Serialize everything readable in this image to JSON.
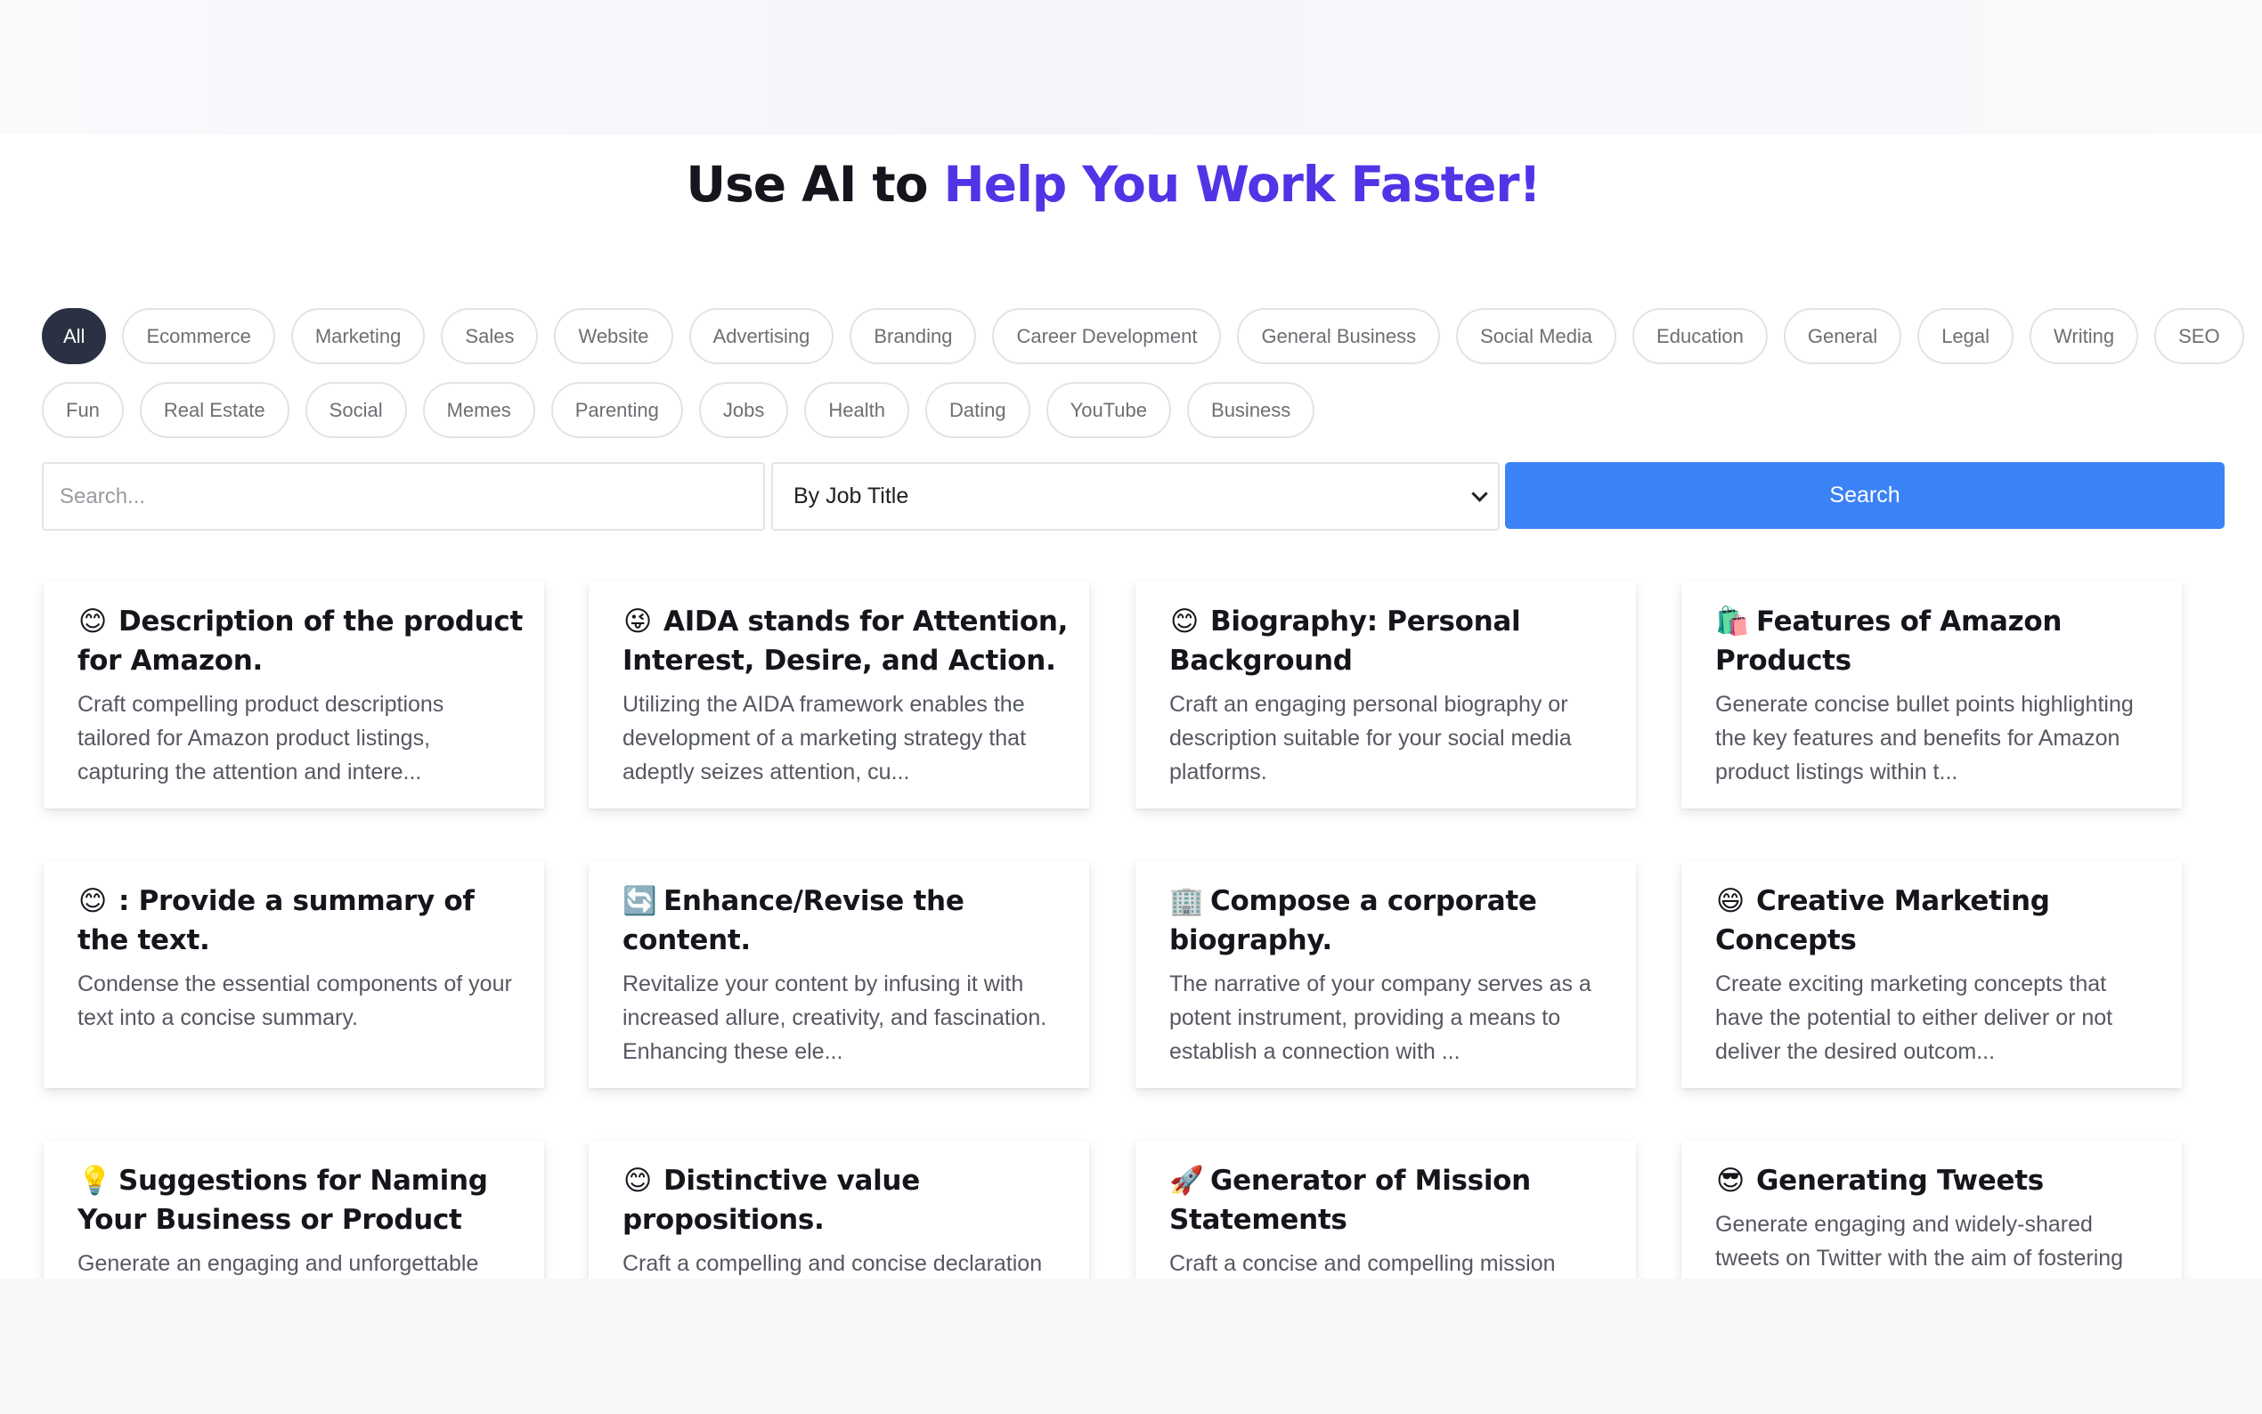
{
  "headline": {
    "part1": "Use AI to ",
    "part2": "Help You Work Faster!"
  },
  "categories": [
    "All",
    "Ecommerce",
    "Marketing",
    "Sales",
    "Website",
    "Advertising",
    "Branding",
    "Career Development",
    "General Business",
    "Social Media",
    "Education",
    "General",
    "Legal",
    "Writing",
    "SEO",
    "Fun",
    "Real Estate",
    "Social",
    "Memes",
    "Parenting",
    "Jobs",
    "Health",
    "Dating",
    "YouTube",
    "Business"
  ],
  "active_category": "All",
  "search": {
    "placeholder": "Search...",
    "value": "",
    "filter_selected": "By Job Title",
    "button_label": "Search"
  },
  "colors": {
    "accent": "#4f35e6",
    "button": "#3b82f6",
    "active_chip": "#2a3142"
  },
  "cards": [
    {
      "emoji": "😊",
      "title": "Description of the product for Amazon.",
      "desc": "Craft compelling product descriptions tailored for Amazon product listings, capturing the attention and intere..."
    },
    {
      "emoji": "😜",
      "title": "AIDA stands for Attention, Interest, Desire, and Action.",
      "desc": "Utilizing the AIDA framework enables the development of a marketing strategy that adeptly seizes attention, cu..."
    },
    {
      "emoji": "😊",
      "title": "Biography: Personal Background",
      "desc": "Craft an engaging personal biography or description suitable for your social media platforms."
    },
    {
      "emoji": "🛍️",
      "title": "Features of Amazon Products",
      "desc": "Generate concise bullet points highlighting the key features and benefits for Amazon product listings within t..."
    },
    {
      "emoji": "😊",
      "title": ": Provide a summary of the text.",
      "desc": "Condense the essential components of your text into a concise summary."
    },
    {
      "emoji": "🔄",
      "title": "Enhance/Revise the content.",
      "desc": "Revitalize your content by infusing it with increased allure, creativity, and fascination. Enhancing these ele..."
    },
    {
      "emoji": "🏢",
      "title": "Compose a corporate biography.",
      "desc": "The narrative of your company serves as a potent instrument, providing a means to establish a connection with ..."
    },
    {
      "emoji": "😄",
      "title": "Creative Marketing Concepts",
      "desc": "Create exciting marketing concepts that have the potential to either deliver or not deliver the desired outcom..."
    },
    {
      "emoji": "💡",
      "title": "Suggestions for Naming Your Business or Product",
      "desc": "Generate an engaging and unforgettable"
    },
    {
      "emoji": "😊",
      "title": "Distinctive value propositions.",
      "desc": "Craft a compelling and concise declaration"
    },
    {
      "emoji": "🚀",
      "title": "Generator of Mission Statements",
      "desc": "Craft a concise and compelling mission"
    },
    {
      "emoji": "😎",
      "title": "Generating Tweets",
      "desc": "Generate engaging and widely-shared tweets on Twitter with the aim of fostering"
    }
  ]
}
